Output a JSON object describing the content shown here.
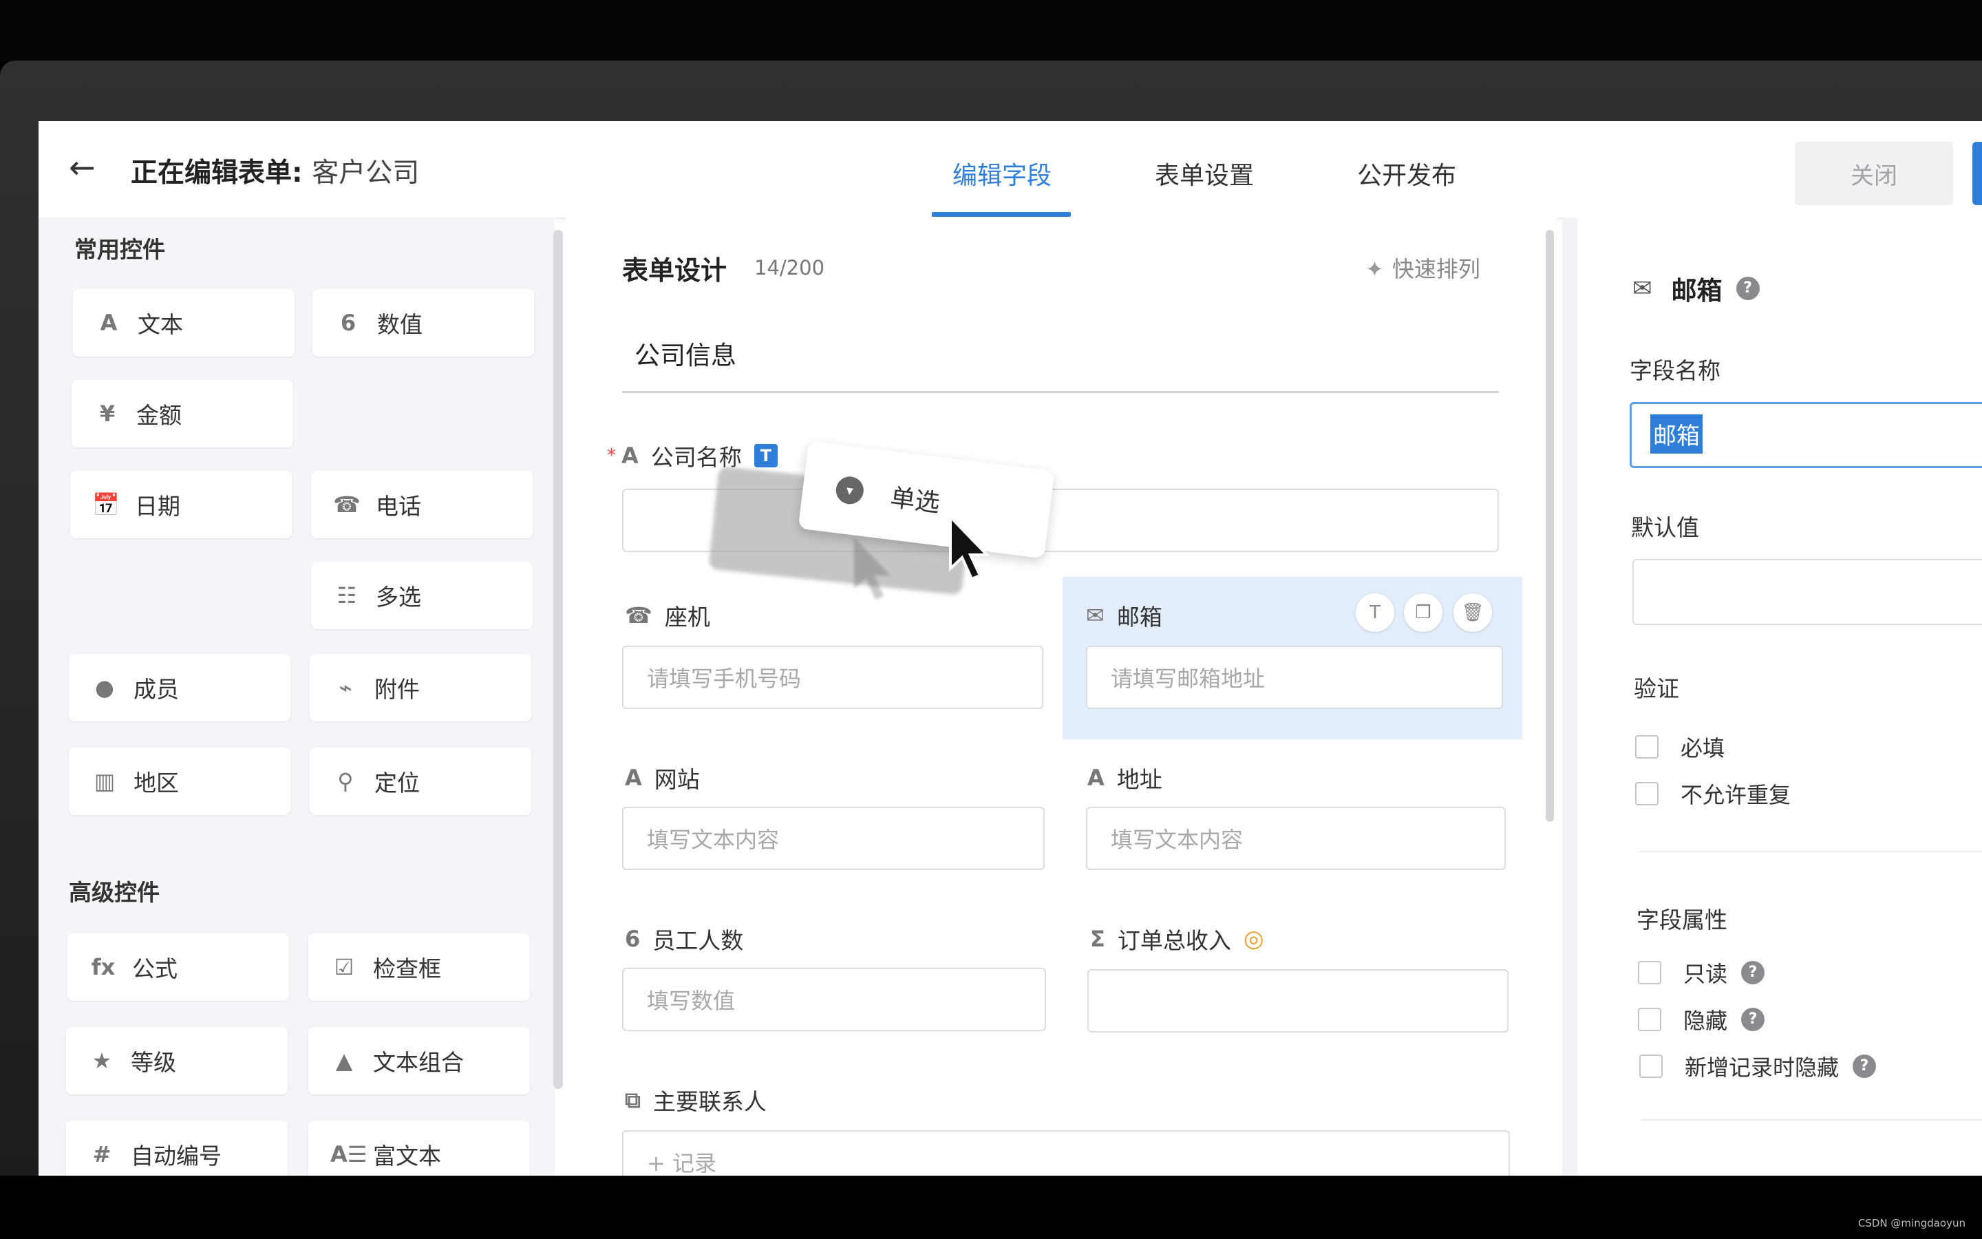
{
  "header": {
    "back_icon": "arrow-left-icon",
    "title_prefix": "正在编辑表单:",
    "title_name": "客户公司",
    "tabs": [
      "编辑字段",
      "表单设置",
      "公开发布"
    ],
    "active_tab": 0,
    "close_label": "关闭"
  },
  "left": {
    "common_title": "常用控件",
    "advanced_title": "高级控件",
    "common": [
      {
        "icon": "A",
        "label": "文本"
      },
      {
        "icon": "6",
        "label": "数值"
      },
      {
        "icon": "¥",
        "label": "金额"
      },
      {
        "icon": "📅",
        "label": "日期"
      },
      {
        "icon": "☎",
        "label": "电话"
      },
      {
        "icon": "☷",
        "label": "多选"
      },
      {
        "icon": "●",
        "label": "成员"
      },
      {
        "icon": "⌁",
        "label": "附件"
      },
      {
        "icon": "▥",
        "label": "地区"
      },
      {
        "icon": "⚲",
        "label": "定位"
      }
    ],
    "advanced": [
      {
        "icon": "fx",
        "label": "公式"
      },
      {
        "icon": "☑",
        "label": "检查框"
      },
      {
        "icon": "★",
        "label": "等级"
      },
      {
        "icon": "▲",
        "label": "文本组合"
      },
      {
        "icon": "#",
        "label": "自动编号"
      },
      {
        "icon": "A☰",
        "label": "富文本"
      }
    ]
  },
  "design": {
    "title": "表单设计",
    "count": "14/200",
    "quick_sort": "快速排列",
    "section": "公司信息",
    "fields": {
      "company": {
        "label": "公司名称",
        "badge": "T",
        "placeholder": ""
      },
      "landline": {
        "label": "座机",
        "placeholder": "请填写手机号码"
      },
      "email": {
        "label": "邮箱",
        "placeholder": "请填写邮箱地址"
      },
      "website": {
        "label": "网站",
        "placeholder": "填写文本内容"
      },
      "address": {
        "label": "地址",
        "placeholder": "填写文本内容"
      },
      "employees": {
        "label": "员工人数",
        "placeholder": "填写数值"
      },
      "revenue": {
        "label": "订单总收入",
        "placeholder": ""
      },
      "contact": {
        "label": "主要联系人",
        "placeholder": "+ 记录"
      }
    },
    "drag_chip": {
      "icon": "dropdown-icon",
      "label": "单选"
    }
  },
  "props": {
    "title": "邮箱",
    "field_name_label": "字段名称",
    "field_name_value": "邮箱",
    "default_label": "默认值",
    "validation_label": "验证",
    "validation": [
      "必填",
      "不允许重复"
    ],
    "attrs_label": "字段属性",
    "attrs": [
      "只读",
      "隐藏",
      "新增记录时隐藏"
    ]
  },
  "watermark": "CSDN @mingdaoyun",
  "colors": {
    "accent": "#2f7fd8",
    "highlight": "#e4eefb",
    "warning": "#e8a235"
  }
}
